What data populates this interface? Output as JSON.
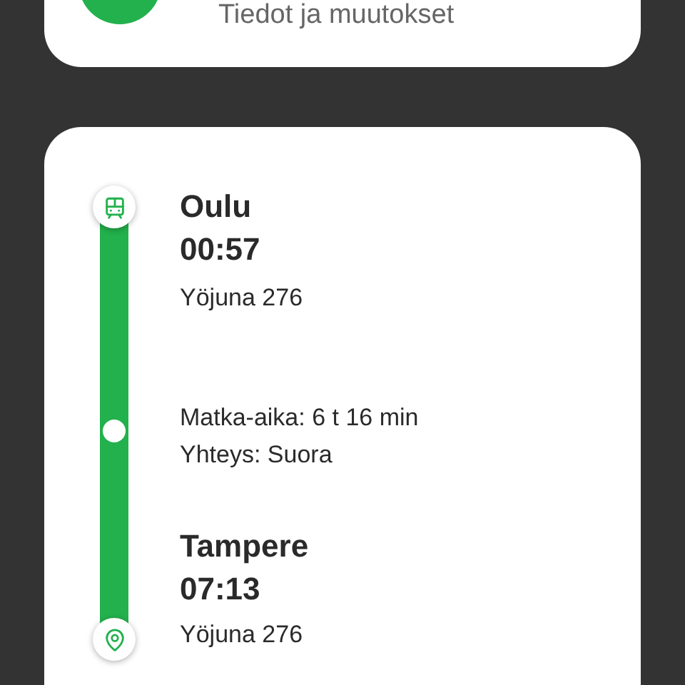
{
  "info_card": {
    "subtitle": "Tiedot ja muutokset"
  },
  "journey": {
    "stops": [
      {
        "kind": "departure",
        "station": "Oulu",
        "time": "00:57",
        "train": "Yöjuna 276"
      },
      {
        "kind": "arrival",
        "station": "Tampere",
        "time": "07:13",
        "train": "Yöjuna 276"
      }
    ],
    "summary": [
      "Matka-aika: 6 t 16 min",
      "Yhteys: Suora"
    ]
  }
}
